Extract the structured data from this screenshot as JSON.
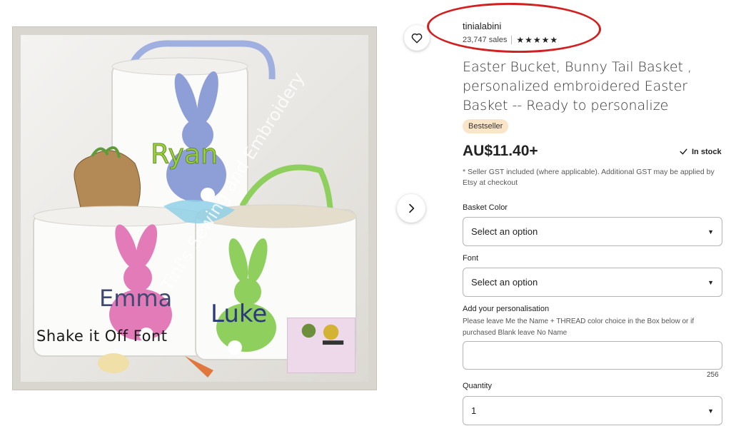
{
  "image": {
    "caption": "Shake it Off Font",
    "names": [
      "Ryan",
      "Emma",
      "Luke"
    ],
    "watermark": "Tini's Sewing and Embroidery",
    "stamp_text": "Tini's Sewing and Embroidery"
  },
  "shop": {
    "name": "tinialabini",
    "sales": "23,747 sales",
    "stars": "★★★★★",
    "annotation_color": "#d21f1f"
  },
  "listing": {
    "title": "Easter Bucket, Bunny Tail Basket , personalized embroidered Easter Basket -- Ready to personalize",
    "badge": "Bestseller",
    "price": "AU$11.40+",
    "stock": "In stock",
    "gst_note": "* Seller GST included (where applicable). Additional GST may be applied by Etsy at checkout"
  },
  "options": {
    "basket_color": {
      "label": "Basket Color",
      "value": "Select an option"
    },
    "font": {
      "label": "Font",
      "value": "Select an option"
    },
    "personalisation": {
      "label": "Add your personalisation",
      "help": "Please leave Me the Name + THREAD color choice in the Box below or if purchased Blank leave No Name",
      "value": "",
      "counter": "256"
    },
    "quantity": {
      "label": "Quantity",
      "value": "1"
    }
  },
  "icons": {
    "favorite": "heart-icon",
    "next": "chevron-right-icon",
    "stock": "check-icon",
    "dropdown": "caret-down-icon"
  },
  "colors": {
    "badge_bg": "#fbe5c8",
    "bunny_blue": "#8e9fd8",
    "bunny_pink": "#e27bb8",
    "bunny_green": "#8ecf5e"
  }
}
